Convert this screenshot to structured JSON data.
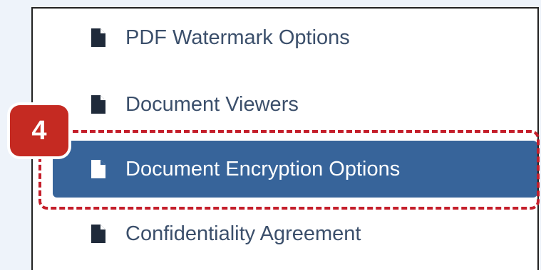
{
  "menu": {
    "items": [
      {
        "label": "PDF Watermark Options",
        "icon": "document-icon",
        "active": false
      },
      {
        "label": "Document Viewers",
        "icon": "document-icon",
        "active": false
      },
      {
        "label": "Document Encryption Options",
        "icon": "document-icon",
        "active": true
      },
      {
        "label": "Confidentiality Agreement",
        "icon": "document-icon",
        "active": false
      }
    ]
  },
  "annotation": {
    "step_number": "4",
    "color": "#c41e2a"
  },
  "colors": {
    "active_bg": "#37649a",
    "item_text": "#3b4f6b",
    "page_bg": "#eef3fa"
  }
}
